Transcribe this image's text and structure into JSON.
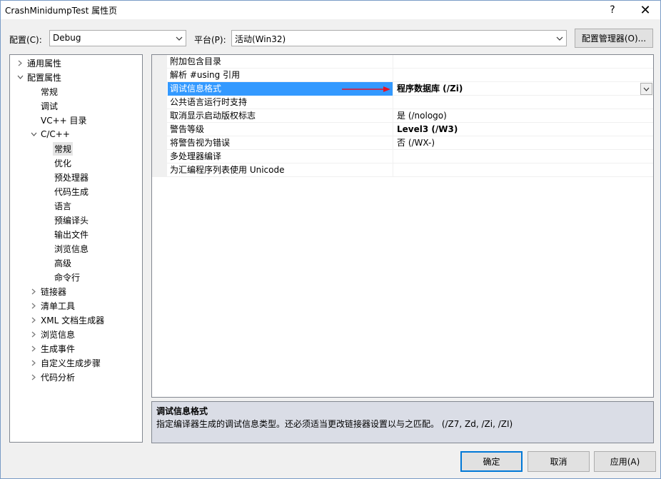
{
  "window": {
    "title": "CrashMinidumpTest 属性页",
    "help_label": "?",
    "close_label": "✕"
  },
  "toolbar": {
    "config_label": "配置(C):",
    "config_value": "Debug",
    "platform_label": "平台(P):",
    "platform_value": "活动(Win32)",
    "config_manager_label": "配置管理器(O)..."
  },
  "tree": {
    "items": [
      {
        "label": "通用属性",
        "chevron": "right"
      },
      {
        "label": "配置属性",
        "chevron": "down"
      },
      {
        "label": "常规"
      },
      {
        "label": "调试"
      },
      {
        "label": "VC++ 目录"
      },
      {
        "label": "C/C++",
        "chevron": "down"
      },
      {
        "label": "常规",
        "selected": true
      },
      {
        "label": "优化"
      },
      {
        "label": "预处理器"
      },
      {
        "label": "代码生成"
      },
      {
        "label": "语言"
      },
      {
        "label": "预编译头"
      },
      {
        "label": "输出文件"
      },
      {
        "label": "浏览信息"
      },
      {
        "label": "高级"
      },
      {
        "label": "命令行"
      },
      {
        "label": "链接器",
        "chevron": "right"
      },
      {
        "label": "清单工具",
        "chevron": "right"
      },
      {
        "label": "XML 文档生成器",
        "chevron": "right"
      },
      {
        "label": "浏览信息",
        "chevron": "right"
      },
      {
        "label": "生成事件",
        "chevron": "right"
      },
      {
        "label": "自定义生成步骤",
        "chevron": "right"
      },
      {
        "label": "代码分析",
        "chevron": "right"
      }
    ]
  },
  "grid": {
    "rows": [
      {
        "name": "附加包含目录",
        "value": ""
      },
      {
        "name": "解析 #using 引用",
        "value": ""
      },
      {
        "name": "调试信息格式",
        "value": "程序数据库 (/Zi)",
        "bold": true,
        "selected": true
      },
      {
        "name": "公共语言运行时支持",
        "value": ""
      },
      {
        "name": "取消显示启动版权标志",
        "value": "是 (/nologo)"
      },
      {
        "name": "警告等级",
        "value": "Level3 (/W3)",
        "bold": true
      },
      {
        "name": "将警告视为错误",
        "value": "否 (/WX-)"
      },
      {
        "name": "多处理器编译",
        "value": ""
      },
      {
        "name": "为汇编程序列表使用 Unicode",
        "value": ""
      }
    ]
  },
  "description": {
    "title": "调试信息格式",
    "text": "指定编译器生成的调试信息类型。还必须适当更改链接器设置以与之匹配。    (/Z7, Zd, /Zi, /ZI)"
  },
  "buttons": {
    "ok": "确定",
    "cancel": "取消",
    "apply": "应用(A)"
  },
  "colors": {
    "selection": "#3399ff",
    "annotation_arrow": "#e81123"
  }
}
